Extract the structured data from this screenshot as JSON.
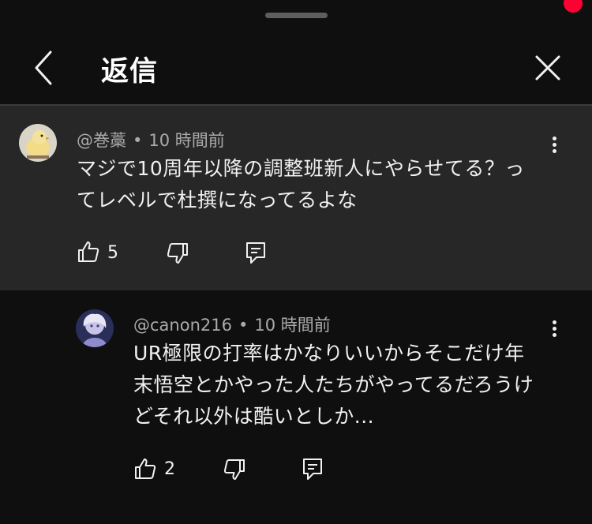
{
  "header": {
    "title": "返信"
  },
  "parent_comment": {
    "handle": "@巻藁",
    "separator": "•",
    "time": "10 時間前",
    "text_line1": "マジで10周年以降の調整班新人にやらせてる？っ",
    "text_line2": "てレベルで杜撰になってるよな",
    "like_count": "5"
  },
  "reply_comment": {
    "handle": "@canon216",
    "separator": "•",
    "time": "10 時間前",
    "text_line1": "UR極限の打率はかなりいいからそこだけ年",
    "text_line2": "末悟空とかやった人たちがやってるだろうけ",
    "text_line3": "どそれ以外は酷いとしか...",
    "like_count": "2"
  },
  "colors": {
    "background": "#0f0f0f",
    "highlight_background": "#272727",
    "notification_dot": "#ff0033",
    "secondary_text": "#aaaaaa"
  },
  "icons": [
    "chevron-left-icon",
    "close-icon",
    "kebab-menu-icon",
    "thumb-up-icon",
    "thumb-down-icon",
    "reply-icon"
  ]
}
